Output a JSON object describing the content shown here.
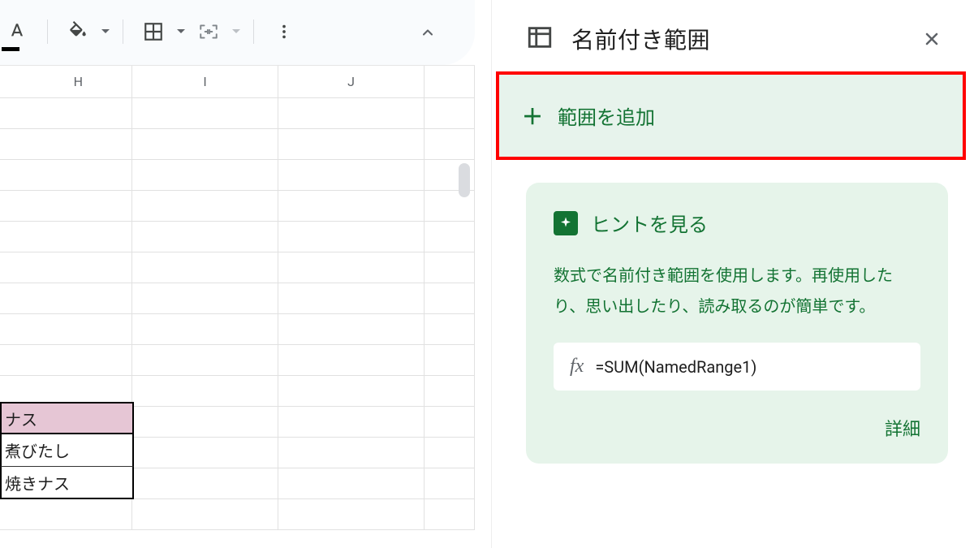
{
  "toolbar": {
    "text_color_icon": "text-color-icon",
    "fill_color_icon": "fill-color-icon",
    "borders_icon": "borders-icon",
    "merge_icon": "merge-cells-icon",
    "more_icon": "more-options-icon",
    "collapse_icon": "collapse-toolbar-icon"
  },
  "columns": [
    "H",
    "I",
    "J"
  ],
  "partial_table": {
    "header": "ナス",
    "rows": [
      "煮びたし",
      "焼きナス"
    ]
  },
  "panel": {
    "title": "名前付き範囲",
    "add_range_label": "範囲を追加",
    "hint": {
      "title": "ヒントを見る",
      "body": "数式で名前付き範囲を使用します。再使用したり、思い出したり、読み取るのが簡単です。",
      "formula": "=SUM(NamedRange1)",
      "fx_label": "fx",
      "details_label": "詳細"
    }
  }
}
